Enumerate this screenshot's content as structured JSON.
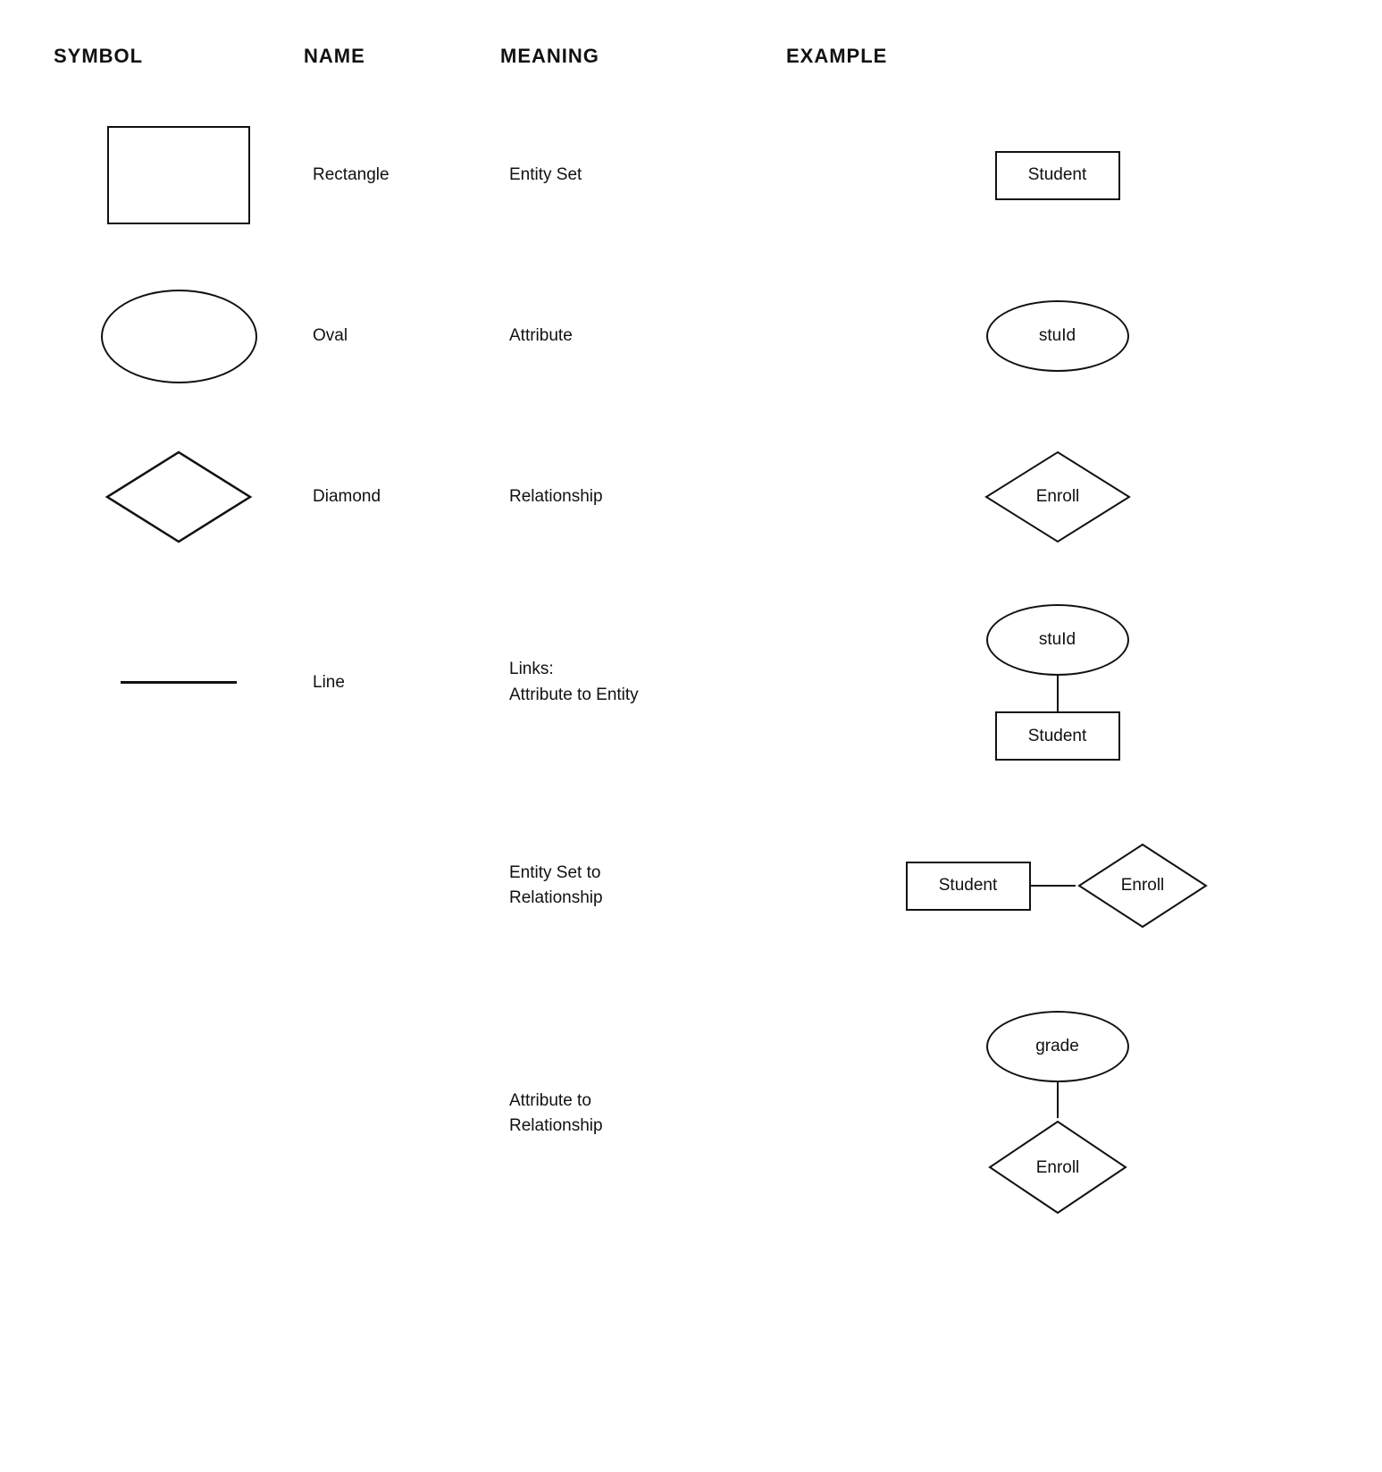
{
  "header": {
    "col1": "SYMBOL",
    "col2": "NAME",
    "col3": "MEANING",
    "col4": "EXAMPLE"
  },
  "rows": [
    {
      "name": "Rectangle",
      "meaning": "Entity Set",
      "example_label": "Student",
      "shape": "rectangle"
    },
    {
      "name": "Oval",
      "meaning": "Attribute",
      "example_label": "stuId",
      "shape": "oval"
    },
    {
      "name": "Diamond",
      "meaning": "Relationship",
      "example_label": "Enroll",
      "shape": "diamond"
    },
    {
      "name": "Line",
      "meaning": "Links:\nAttribute to Entity",
      "example_oval": "stuId",
      "example_rect": "Student",
      "shape": "line"
    }
  ],
  "extra_rows": [
    {
      "meaning": "Entity Set to\nRelationship",
      "example_rect": "Student",
      "example_diamond": "Enroll"
    },
    {
      "meaning": "Attribute to\nRelationship",
      "example_oval": "grade",
      "example_diamond": "Enroll"
    }
  ]
}
